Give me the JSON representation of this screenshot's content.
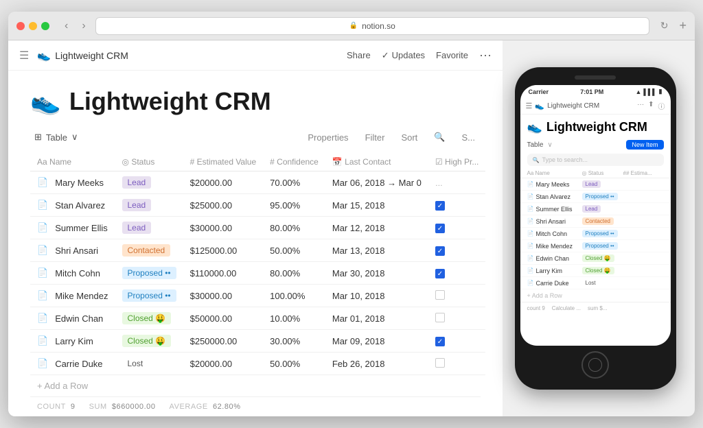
{
  "browser": {
    "url": "notion.so",
    "back_btn": "‹",
    "forward_btn": "›",
    "reload_btn": "↻",
    "new_tab_btn": "+"
  },
  "nav": {
    "hamburger": "☰",
    "icon": "👟",
    "title": "Lightweight CRM",
    "share": "Share",
    "updates_check": "✓",
    "updates": "Updates",
    "favorite": "Favorite",
    "dots": "···"
  },
  "page": {
    "title": "Lightweight CRM",
    "icon": "👟",
    "table_view": "Table",
    "table_icon": "⊞",
    "chevron": "∨",
    "properties": "Properties",
    "filter": "Filter",
    "sort": "Sort",
    "search_icon": "🔍",
    "more": "S..."
  },
  "table": {
    "columns": [
      "Name",
      "Status",
      "# Estimated Value",
      "# Confidence",
      "Last Contact",
      "High Pr..."
    ],
    "column_icons": [
      "Aa",
      "◎",
      "#",
      "#",
      "📅",
      "☑"
    ],
    "rows": [
      {
        "name": "Mary Meeks",
        "status": "Lead",
        "status_type": "lead",
        "value": "$20000.00",
        "confidence": "70.00%",
        "contact": "Mar 06, 2018 → Mar 0",
        "high_priority": false,
        "hp_partial": true
      },
      {
        "name": "Stan Alvarez",
        "status": "Lead",
        "status_type": "lead",
        "value": "$25000.00",
        "confidence": "95.00%",
        "contact": "Mar 15, 2018",
        "high_priority": true
      },
      {
        "name": "Summer Ellis",
        "status": "Lead",
        "status_type": "lead",
        "value": "$30000.00",
        "confidence": "80.00%",
        "contact": "Mar 12, 2018",
        "high_priority": true
      },
      {
        "name": "Shri Ansari",
        "status": "Contacted",
        "status_type": "contacted",
        "value": "$125000.00",
        "confidence": "50.00%",
        "contact": "Mar 13, 2018",
        "high_priority": true
      },
      {
        "name": "Mitch Cohn",
        "status": "Proposed ••",
        "status_type": "proposed",
        "value": "$110000.00",
        "confidence": "80.00%",
        "contact": "Mar 30, 2018",
        "high_priority": true
      },
      {
        "name": "Mike Mendez",
        "status": "Proposed ••",
        "status_type": "proposed",
        "value": "$30000.00",
        "confidence": "100.00%",
        "contact": "Mar 10, 2018",
        "high_priority": false
      },
      {
        "name": "Edwin Chan",
        "status": "Closed 🤑",
        "status_type": "closed",
        "value": "$50000.00",
        "confidence": "10.00%",
        "contact": "Mar 01, 2018",
        "high_priority": false
      },
      {
        "name": "Larry Kim",
        "status": "Closed 🤑",
        "status_type": "closed",
        "value": "$250000.00",
        "confidence": "30.00%",
        "contact": "Mar 09, 2018",
        "high_priority": true
      },
      {
        "name": "Carrie Duke",
        "status": "Lost",
        "status_type": "lost",
        "value": "$20000.00",
        "confidence": "50.00%",
        "contact": "Feb 26, 2018",
        "high_priority": false
      }
    ],
    "add_row": "+ Add a Row",
    "footer": {
      "count_label": "COUNT",
      "count_value": "9",
      "sum_label": "SUM",
      "sum_value": "$660000.00",
      "average_label": "AVERAGE",
      "average_value": "62.80%"
    }
  },
  "phone": {
    "carrier": "Carrier",
    "time": "7:01 PM",
    "icon": "👟",
    "title": "Lightweight CRM",
    "table": "Table",
    "new_btn": "New Item",
    "search_placeholder": "Type to search...",
    "col_name": "Aa Name",
    "col_status": "◎ Status",
    "col_estimated": "## Estima...",
    "rows": [
      {
        "name": "Mary Meeks",
        "status": "Lead",
        "status_type": "lead"
      },
      {
        "name": "Stan Alvarez",
        "status": "Proposed ••",
        "status_type": "proposed"
      },
      {
        "name": "Summer Ellis",
        "status": "Lead",
        "status_type": "lead"
      },
      {
        "name": "Shri Ansari",
        "status": "Contacted",
        "status_type": "contacted"
      },
      {
        "name": "Mitch Cohn",
        "status": "Proposed ••",
        "status_type": "proposed"
      },
      {
        "name": "Mike Mendez",
        "status": "Proposed ••",
        "status_type": "proposed"
      },
      {
        "name": "Edwin Chan",
        "status": "Closed 🤑",
        "status_type": "closed"
      },
      {
        "name": "Larry Kim",
        "status": "Closed 🤑",
        "status_type": "closed"
      },
      {
        "name": "Carrie Duke",
        "status": "Lost",
        "status_type": "lost"
      }
    ],
    "add_row": "+ Add a Row",
    "count_label": "count",
    "count_value": "9",
    "calculate": "Calculate ...",
    "sum": "sum $..."
  }
}
